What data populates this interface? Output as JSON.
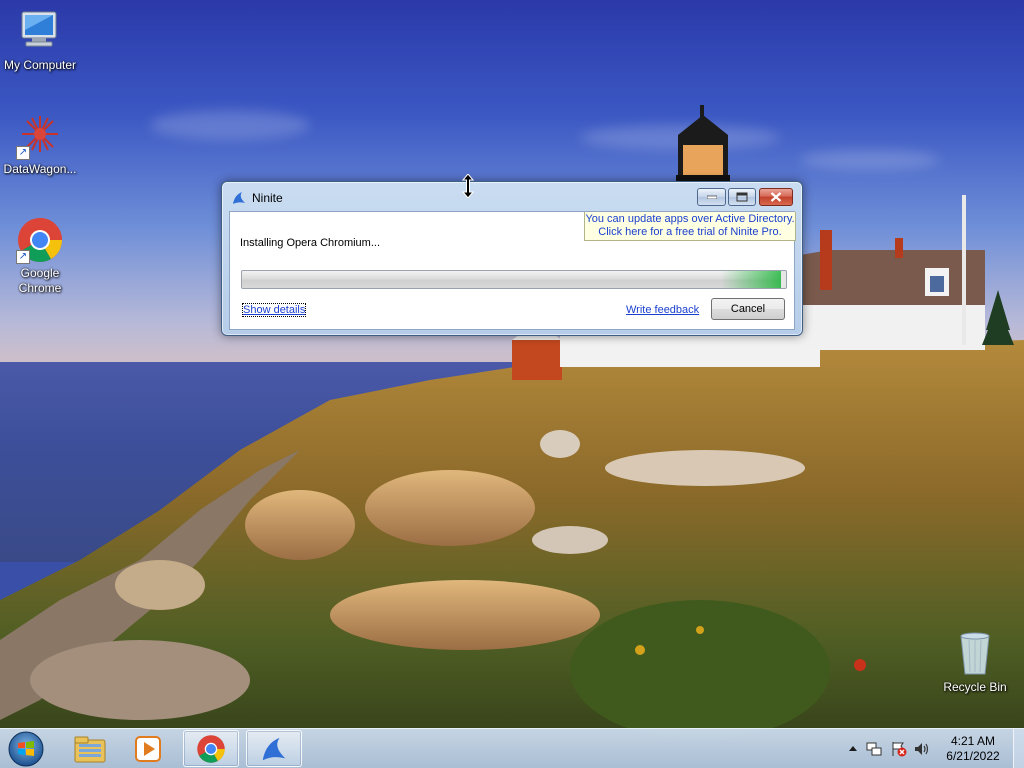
{
  "desktop": {
    "icons": [
      {
        "label": "My Computer",
        "icon": "computer-icon"
      },
      {
        "label": "DataWagon...",
        "icon": "datawagon-icon"
      },
      {
        "label": "Google Chrome",
        "icon": "chrome-icon"
      },
      {
        "label": "Recycle Bin",
        "icon": "recycle-bin-icon"
      }
    ]
  },
  "window": {
    "title": "Ninite",
    "status_text": "Installing Opera Chromium...",
    "promo_line1": "You can update apps over Active Directory.",
    "promo_line2": "Click here for a free trial of Ninite Pro.",
    "progress_fraction": 0.99,
    "show_details_label": "Show details",
    "write_feedback_label": "Write feedback",
    "cancel_label": "Cancel"
  },
  "taskbar": {
    "pinned": [
      "windows-explorer-icon",
      "media-player-icon",
      "chrome-icon",
      "ninite-icon"
    ],
    "active_item": "ninite-icon",
    "clock_time": "4:21 AM",
    "clock_date": "6/21/2022"
  },
  "colors": {
    "link": "#1a3fd0",
    "progress_green": "#06b025",
    "promo_bg": "#ffffe1"
  }
}
